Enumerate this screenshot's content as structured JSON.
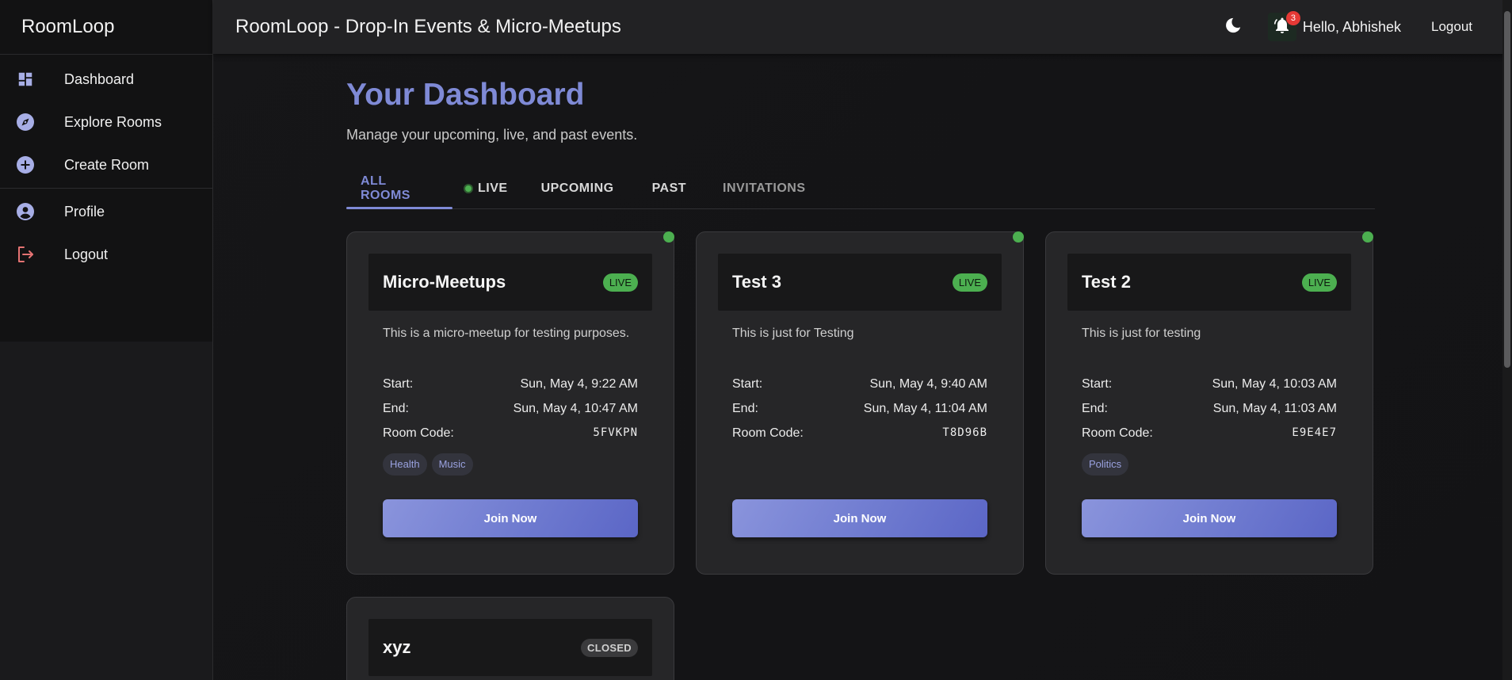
{
  "sidebar": {
    "brand": "RoomLoop",
    "items": [
      {
        "label": "Dashboard",
        "icon": "dashboard-icon"
      },
      {
        "label": "Explore Rooms",
        "icon": "compass-icon"
      },
      {
        "label": "Create Room",
        "icon": "add-circle-icon"
      },
      {
        "label": "Profile",
        "icon": "account-circle-icon"
      },
      {
        "label": "Logout",
        "icon": "logout-icon"
      }
    ]
  },
  "topbar": {
    "title": "RoomLoop - Drop-In Events & Micro-Meetups",
    "notification_count": "3",
    "greeting": "Hello, Abhishek",
    "logout": "Logout"
  },
  "main": {
    "title": "Your Dashboard",
    "subtitle": "Manage your upcoming, live, and past events.",
    "tabs": [
      "ALL ROOMS",
      "LIVE",
      "UPCOMING",
      "PAST",
      "INVITATIONS"
    ]
  },
  "labels": {
    "start": "Start:",
    "end": "End:",
    "room_code": "Room Code:",
    "join": "Join Now"
  },
  "rooms": [
    {
      "title": "Micro-Meetups",
      "status": "LIVE",
      "description": "This is a micro-meetup for testing purposes.",
      "start": "Sun, May 4, 9:22 AM",
      "end": "Sun, May 4, 10:47 AM",
      "code": "5FVKPN",
      "tags": [
        "Health",
        "Music"
      ]
    },
    {
      "title": "Test 3",
      "status": "LIVE",
      "description": "This is just for Testing",
      "start": "Sun, May 4, 9:40 AM",
      "end": "Sun, May 4, 11:04 AM",
      "code": "T8D96B",
      "tags": []
    },
    {
      "title": "Test 2",
      "status": "LIVE",
      "description": "This is just for testing",
      "start": "Sun, May 4, 10:03 AM",
      "end": "Sun, May 4, 11:03 AM",
      "code": "E9E4E7",
      "tags": [
        "Politics"
      ]
    },
    {
      "title": "xyz",
      "status": "CLOSED"
    }
  ],
  "colors": {
    "accent": "#7f8ad6",
    "live": "#4caf50",
    "danger": "#e57373",
    "badge": "#e53935"
  }
}
